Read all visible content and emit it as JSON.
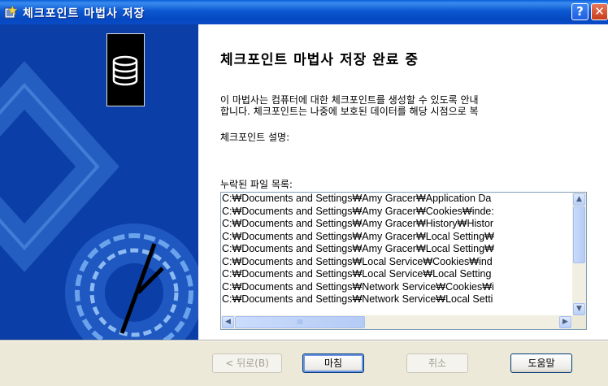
{
  "window": {
    "title": "체크포인트 마법사 저장",
    "help_label": "?",
    "close_label": "✕"
  },
  "content": {
    "heading": "체크포인트 마법사 저장 완료 중",
    "description": "이 마법사는 컴퓨터에 대한 체크포인트를 생성할 수 있도록 안내\n합니다. 체크포인트는 나중에 보호된 데이터를 해당 시점으로 복",
    "checkpoint_description_label": "체크포인트 설명:",
    "missing_files_label": "누락된 파일 목록:"
  },
  "file_list": [
    "C:₩Documents and Settings₩Amy Gracer₩Application Da",
    "C:₩Documents and Settings₩Amy Gracer₩Cookies₩inde:",
    "C:₩Documents and Settings₩Amy Gracer₩History₩Histor",
    "C:₩Documents and Settings₩Amy Gracer₩Local Setting₩",
    "C:₩Documents and Settings₩Amy Gracer₩Local Setting₩",
    "C:₩Documents and Settings₩Local Service₩Cookies₩ind",
    "C:₩Documents and Settings₩Local Service₩Local Setting",
    "C:₩Documents and Settings₩Network Service₩Cookies₩i",
    "C:₩Documents and Settings₩Network Service₩Local Setti"
  ],
  "scroll": {
    "up_arrow": "▲",
    "down_arrow": "▼",
    "left_arrow": "◀",
    "right_arrow": "▶",
    "thumb_grip": "III"
  },
  "buttons": {
    "back": "< 뒤로(B)",
    "finish": "마침",
    "cancel": "취소",
    "help": "도움말"
  },
  "icons": {
    "title_icon": "wizard-icon",
    "sidebar_icon": "database-stack-icon"
  },
  "colors": {
    "title_bar": "#0b57d0",
    "sidebar": "#0b3ea6",
    "dialog_bg": "#ece9d8"
  }
}
